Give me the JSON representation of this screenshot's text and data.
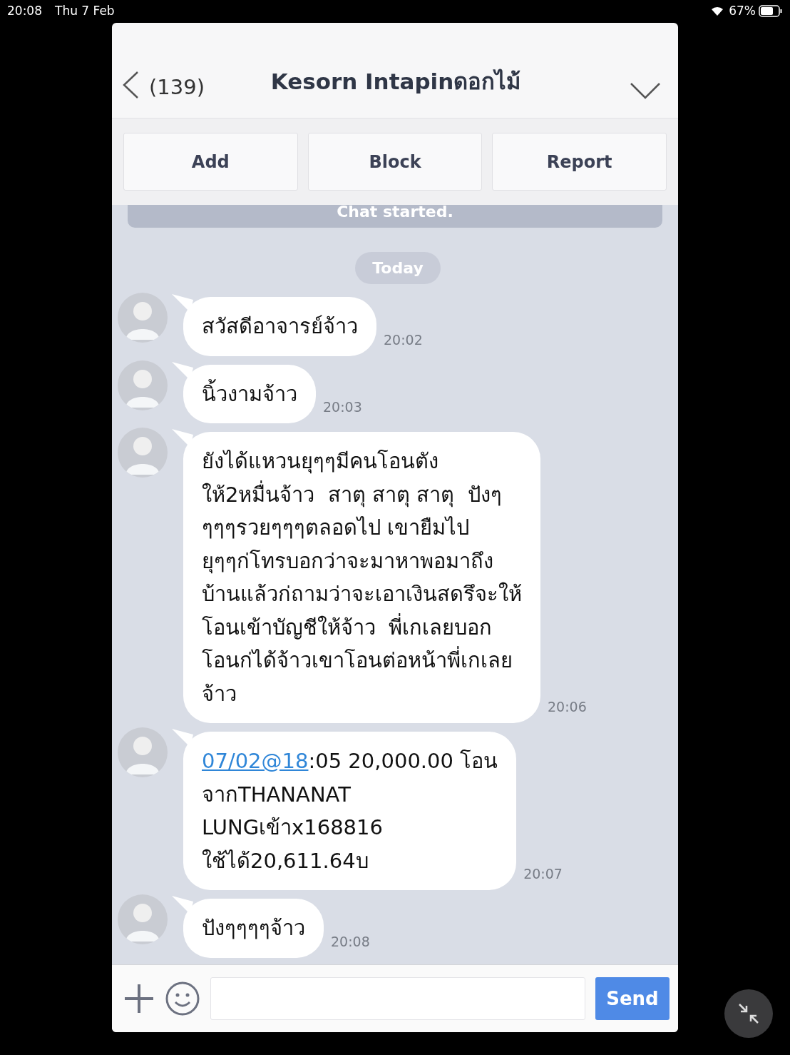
{
  "status_bar": {
    "time": "20:08",
    "date": "Thu 7 Feb",
    "battery": "67%"
  },
  "header": {
    "unread": "(139)",
    "title": "Kesorn Intapinดอกไม้"
  },
  "actions": [
    "Add",
    "Block",
    "Report"
  ],
  "notice": "Chat started.",
  "date_chip": "Today",
  "messages": [
    {
      "kind": "text",
      "lines": [
        "สวัสดีอาจารย์จ้าว"
      ],
      "time": "20:02"
    },
    {
      "kind": "text",
      "lines": [
        "นิ้วงามจ้าว"
      ],
      "time": "20:03"
    },
    {
      "kind": "text",
      "lines": [
        "ยังได้แหวนยุๆๆมีคนโอนตัง",
        "ให้2หมื่นจ้าว  สาตุ สาตุ สาตุ  ปังๆ",
        "ๆๆๆรวยๆๆๆตลอดไป เขายืมไป",
        "ยุๆๆก่โทรบอกว่าจะมาหาพอมาถึง",
        "บ้านแล้วก่ถามว่าจะเอาเงินสดรึจะให้",
        "โอนเข้าบัญชีให้จ้าว  พี่เกเลยบอก",
        "โอนก่ได้จ้าวเขาโอนต่อหน้าพี่เกเลย",
        "จ้าว"
      ],
      "time": "20:06"
    },
    {
      "kind": "link",
      "link": "07/02@18",
      "lines": [
        ":05 20,000.00 โอน",
        "จากTHANANAT",
        "LUNGเข้าx168816",
        "ใช้ได้20,611.64บ"
      ],
      "time": "20:07"
    },
    {
      "kind": "text",
      "lines": [
        "ปังๆๆๆๆจ้าว"
      ],
      "time": "20:08"
    }
  ],
  "composer": {
    "send": "Send"
  }
}
